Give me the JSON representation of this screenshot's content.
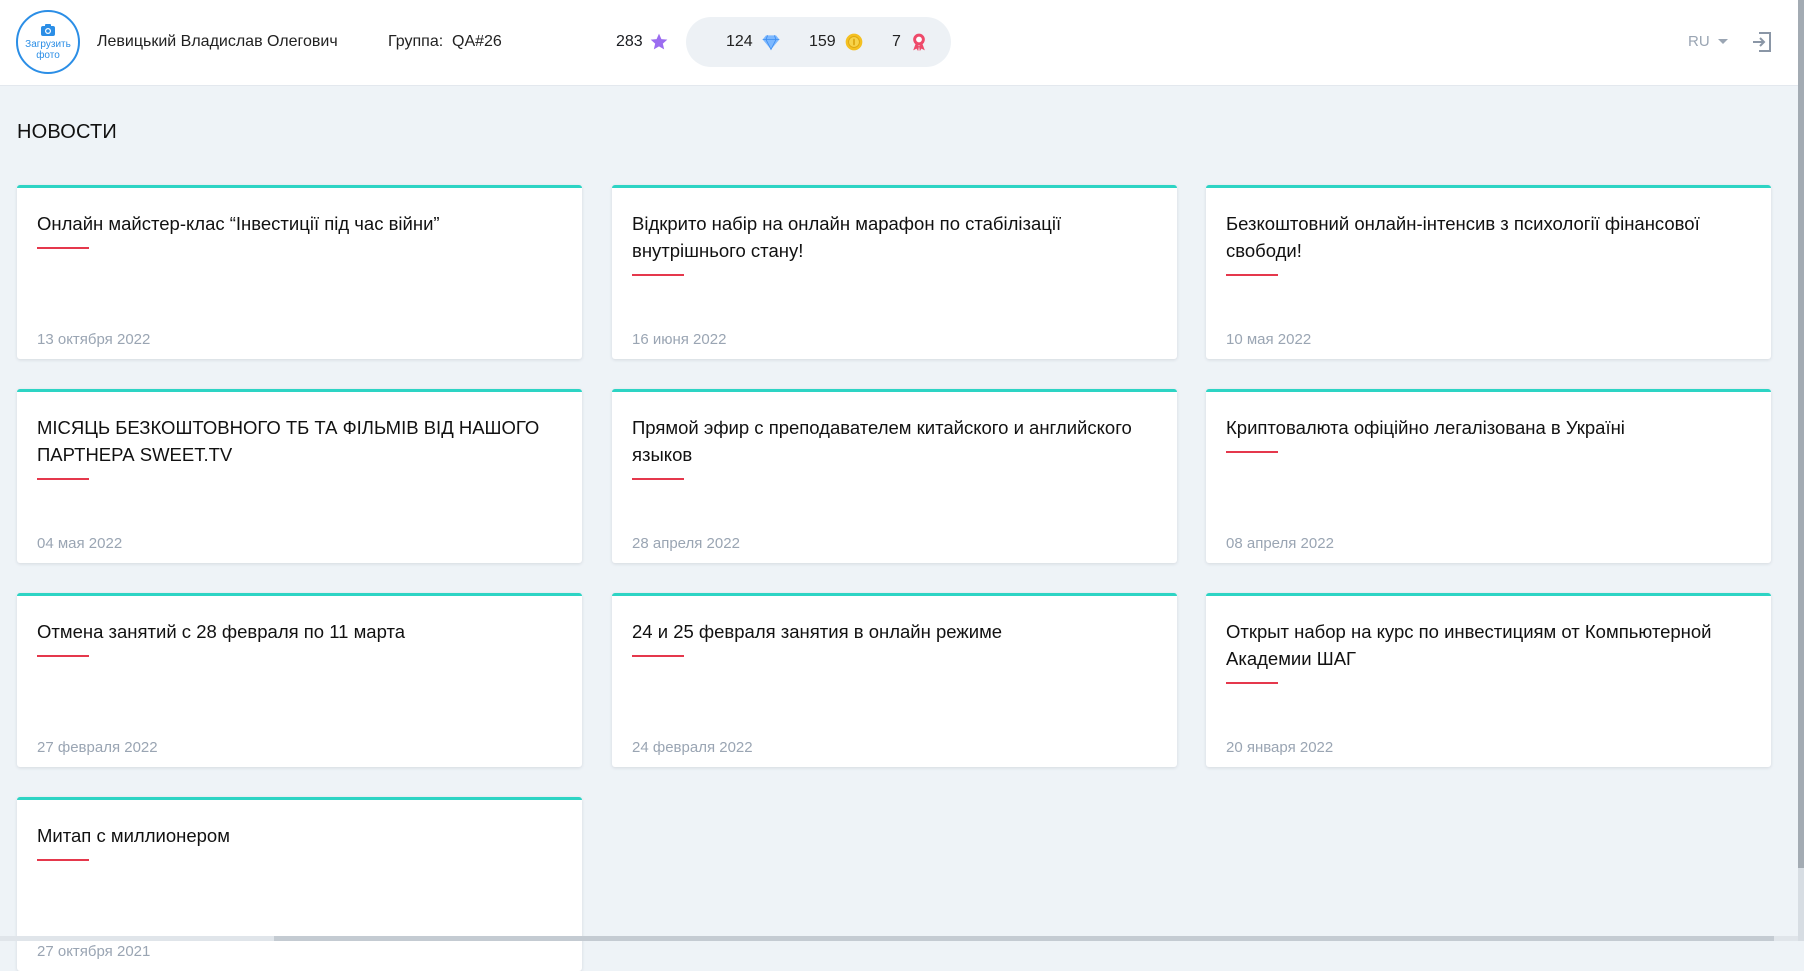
{
  "header": {
    "upload_photo_label": "Загрузить фото",
    "user_name": "Левицький Владислав Олегович",
    "group_label": "Группа:",
    "group_value": "QA#26",
    "stars": "283",
    "diamonds": "124",
    "coins": "159",
    "badges": "7",
    "language": "RU"
  },
  "icons": {
    "camera": "camera-icon",
    "star": "star-icon",
    "diamond": "diamond-icon",
    "coin": "coin-icon",
    "badge": "award-icon",
    "logout": "logout-icon"
  },
  "colors": {
    "accent_teal": "#2dd4c4",
    "underline_red": "#e5384c",
    "primary_blue": "#2b8ee6",
    "date_gray": "#9aa5b3",
    "star_purple": "#9b6cf0",
    "coin_yellow": "#f4c021",
    "badge_red": "#ee4a6a"
  },
  "page": {
    "title": "НОВОСТИ"
  },
  "news": [
    {
      "title": "Онлайн майстер-клас “Інвестиції під час війни”",
      "date": "13 октября 2022"
    },
    {
      "title": "Відкрито набір на онлайн марафон по стабілізації внутрішнього стану!",
      "date": "16 июня 2022"
    },
    {
      "title": "Безкоштовний онлайн-інтенсив з психології фінансової свободи!",
      "date": "10 мая 2022"
    },
    {
      "title": "МІСЯЦЬ БЕЗКОШТОВНОГО ТБ ТА ФІЛЬМІВ ВІД НАШОГО ПАРТНЕРА SWEET.TV",
      "date": "04 мая 2022"
    },
    {
      "title": "Прямой эфир с преподавателем китайского и английского языков",
      "date": "28 апреля 2022"
    },
    {
      "title": "Криптовалюта офіційно легалізована в Україні",
      "date": "08 апреля 2022"
    },
    {
      "title": "Отмена занятий с 28 февраля по 11 марта",
      "date": "27 февраля 2022"
    },
    {
      "title": "24 и 25 февраля занятия в онлайн режиме",
      "date": "24 февраля 2022"
    },
    {
      "title": "Открыт набор на курс по инвестициям от Компьютерной Академии ШАГ",
      "date": "20 января 2022"
    },
    {
      "title": "Митап с миллионером",
      "date": "27 октября 2021"
    }
  ]
}
